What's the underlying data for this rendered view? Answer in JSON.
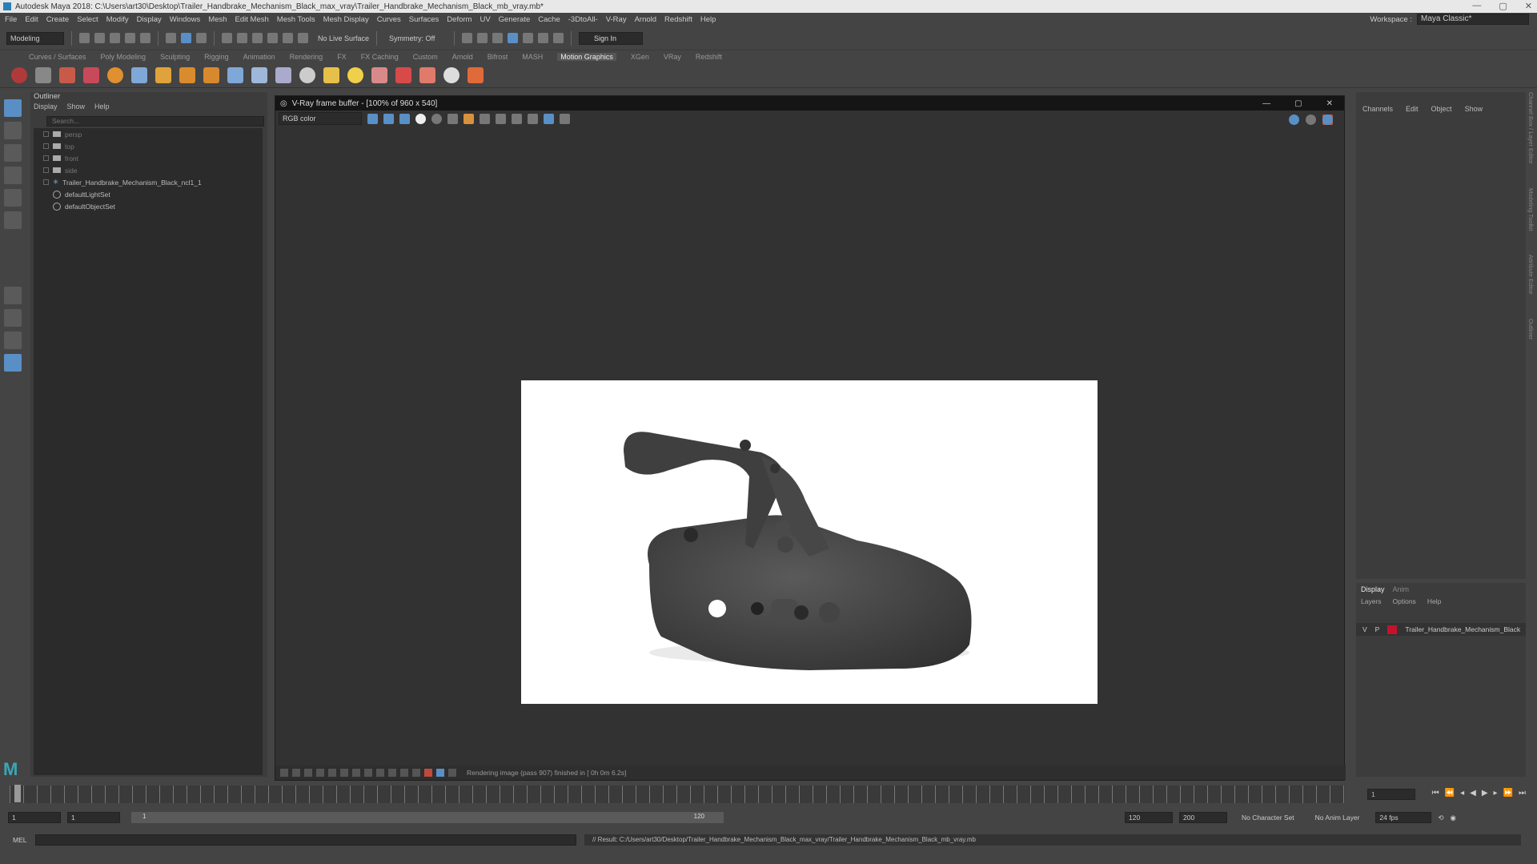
{
  "window": {
    "title": "Autodesk Maya 2018: C:\\Users\\art30\\Desktop\\Trailer_Handbrake_Mechanism_Black_max_vray\\Trailer_Handbrake_Mechanism_Black_mb_vray.mb*",
    "min": "—",
    "max": "▢",
    "close": "✕"
  },
  "menubar": {
    "items": [
      "File",
      "Edit",
      "Create",
      "Select",
      "Modify",
      "Display",
      "Windows",
      "Mesh",
      "Edit Mesh",
      "Mesh Tools",
      "Mesh Display",
      "Curves",
      "Surfaces",
      "Deform",
      "UV",
      "Generate",
      "Cache",
      "-3DtoAll-",
      "V-Ray",
      "Arnold",
      "Redshift",
      "Help"
    ],
    "workspace_label": "Workspace :",
    "workspace_value": "Maya Classic*"
  },
  "statusline": {
    "mode": "Modeling",
    "live_surface": "No Live Surface",
    "symmetry": "Symmetry: Off",
    "sign_in": "Sign In"
  },
  "shelf_tabs": [
    "Curves / Surfaces",
    "Poly Modeling",
    "Sculpting",
    "Rigging",
    "Animation",
    "Rendering",
    "FX",
    "FX Caching",
    "Custom",
    "Arnold",
    "Bifrost",
    "MASH",
    "Motion Graphics",
    "XGen",
    "VRay",
    "Redshift"
  ],
  "shelf_active": "Motion Graphics",
  "outliner": {
    "title": "Outliner",
    "menu": [
      "Display",
      "Show",
      "Help"
    ],
    "search_placeholder": "Search...",
    "items": [
      {
        "label": "persp",
        "type": "camera"
      },
      {
        "label": "top",
        "type": "camera"
      },
      {
        "label": "front",
        "type": "camera"
      },
      {
        "label": "side",
        "type": "camera"
      },
      {
        "label": "Trailer_Handbrake_Mechanism_Black_ncl1_1",
        "type": "group"
      },
      {
        "label": "defaultLightSet",
        "type": "set"
      },
      {
        "label": "defaultObjectSet",
        "type": "set"
      }
    ]
  },
  "vfb": {
    "title": "V-Ray frame buffer - [100% of 960 x 540]",
    "channel": "RGB color",
    "status": "Rendering image (pass 907) finished in [ 0h 0m 6.2s]"
  },
  "channelbox": {
    "menu": [
      "Channels",
      "Edit",
      "Object",
      "Show"
    ]
  },
  "layers": {
    "tabs": [
      "Display",
      "Anim"
    ],
    "menu": [
      "Layers",
      "Options",
      "Help"
    ],
    "row": {
      "v": "V",
      "p": "P",
      "name": "Trailer_Handbrake_Mechanism_Black",
      "color": "#c4122d"
    }
  },
  "side_tabs": [
    "Channel Box / Layer Editor",
    "Modeling Toolkit",
    "Attribute Editor",
    "Outliner"
  ],
  "timeline": {
    "current_frame": "1",
    "start": "1",
    "playback_start": "1",
    "range_start_label": "1",
    "range_end_label": "120",
    "playback_end": "120",
    "end": "200",
    "character_set": "No Character Set",
    "anim_layer": "No Anim Layer",
    "fps": "24 fps"
  },
  "cmdline": {
    "label": "MEL",
    "result": "// Result: C:/Users/art30/Desktop/Trailer_Handbrake_Mechanism_Black_max_vray/Trailer_Handbrake_Mechanism_Black_mb_vray.mb"
  }
}
